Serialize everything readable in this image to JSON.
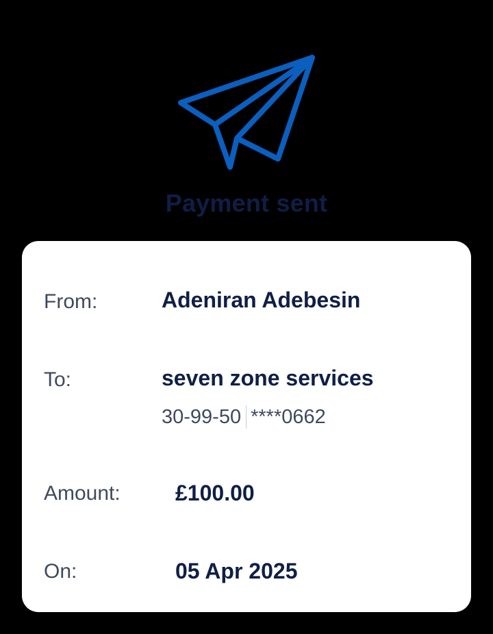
{
  "header": {
    "icon": "paper-plane-icon",
    "title": "Payment sent"
  },
  "details": {
    "from_label": "From:",
    "from_value": "Adeniran Adebesin",
    "to_label": "To:",
    "to_value": "seven zone services",
    "sort_code": "30-99-50",
    "account_number": "****0662",
    "amount_label": "Amount:",
    "amount_value": "£100.00",
    "on_label": "On:",
    "on_value": "05 Apr 2025"
  },
  "colors": {
    "background": "#000000",
    "accent": "#0a5fbf",
    "title": "#101e45",
    "value_text": "#0f1f45",
    "label_text": "#3f4a5c",
    "card": "#ffffff"
  }
}
